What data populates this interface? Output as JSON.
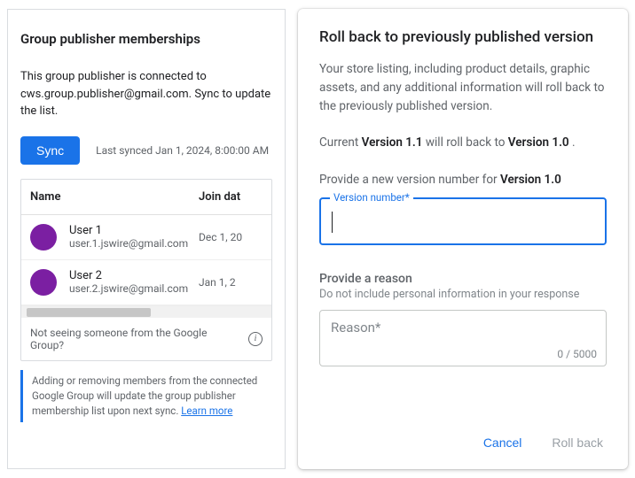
{
  "left": {
    "title": "Group publisher memberships",
    "description": "This group publisher is connected to cws.group.publisher@gmail.com. Sync to update the list.",
    "sync_label": "Sync",
    "last_synced": "Last synced Jan 1, 2024, 8:00:00 AM",
    "columns": {
      "name": "Name",
      "join_date": "Join dat"
    },
    "users": [
      {
        "name": "User 1",
        "email": "user.1.jswire@gmail.com",
        "joined": "Dec 1, 20"
      },
      {
        "name": "User 2",
        "email": "user.2.jswire@gmail.com",
        "joined": "Jan 1, 2"
      }
    ],
    "not_seeing": "Not seeing someone from the Google Group?",
    "info_glyph": "i",
    "note_text": "Adding or removing members from the connected Google Group will update the group publisher membership list upon next sync. ",
    "learn_more": "Learn more"
  },
  "right": {
    "title": "Roll back to previously published version",
    "description": "Your store listing, including product details, graphic assets, and any additional information will roll back to the previously published version.",
    "version_line": {
      "pre": "Current ",
      "current": "Version 1.1",
      "mid": " will roll back to ",
      "target": "Version 1.0",
      "post": " ."
    },
    "provide_version": {
      "pre": "Provide a new version number for ",
      "target": "Version 1.0"
    },
    "version_field_label": "Version number*",
    "version_field_value": "",
    "reason_heading": "Provide a reason",
    "reason_sub": "Do not include personal information in your response",
    "reason_placeholder": "Reason*",
    "reason_value": "",
    "char_count": "0 / 5000",
    "actions": {
      "cancel": "Cancel",
      "rollback": "Roll back"
    }
  }
}
